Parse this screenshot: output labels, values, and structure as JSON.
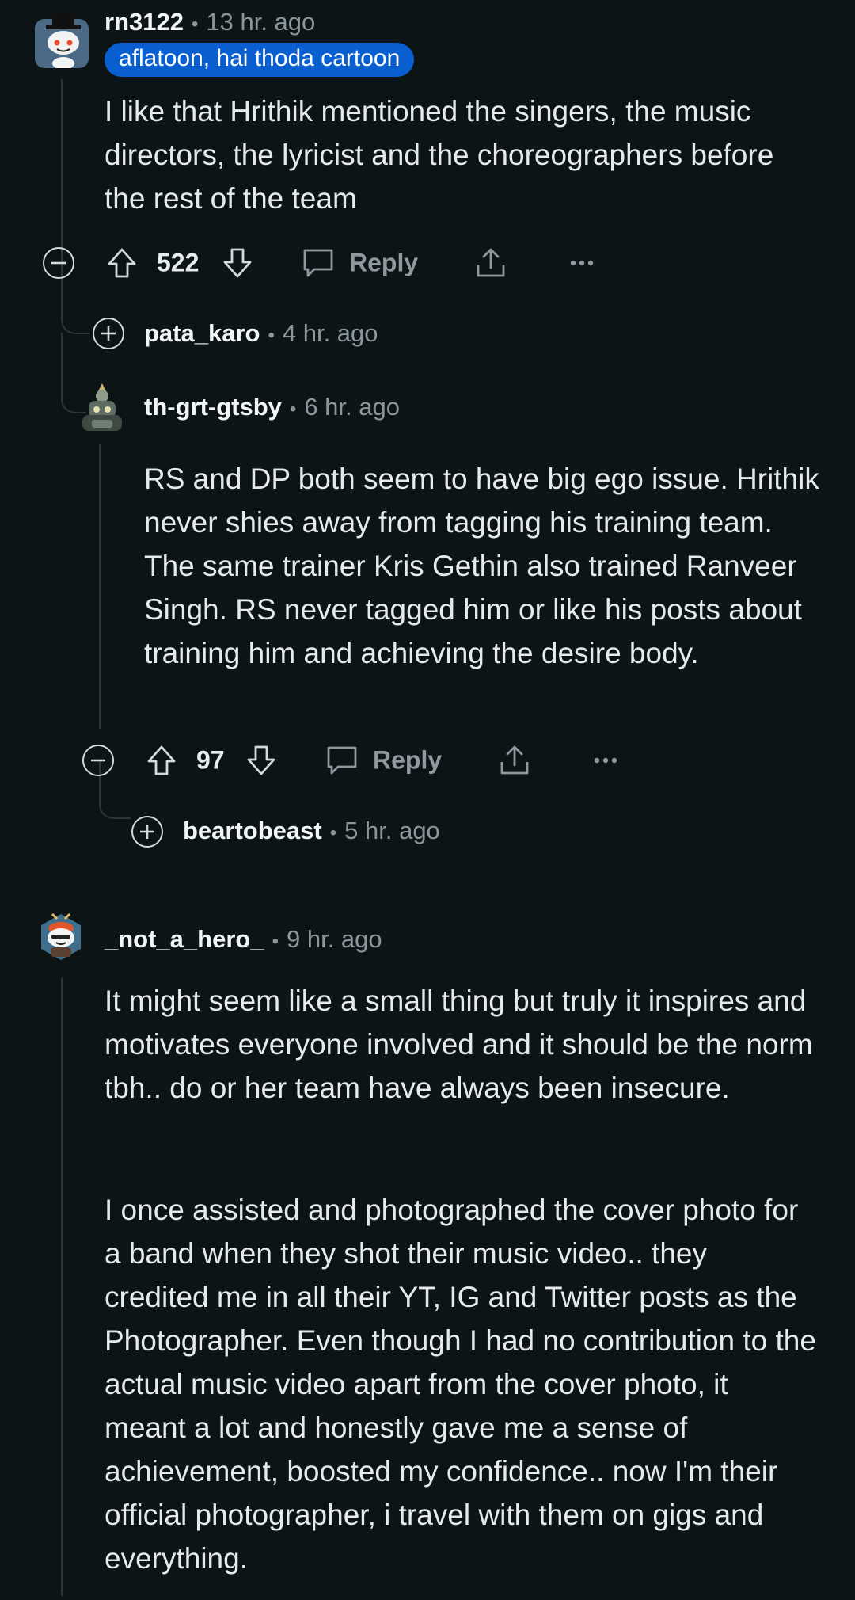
{
  "comments": [
    {
      "username": "rn3122",
      "time": "13 hr. ago",
      "flair": "aflatoon, hai thoda cartoon",
      "text": "I like that Hrithik mentioned the singers, the music directors, the lyricist and the choreographers before the rest of the team",
      "votes": "522",
      "reply_label": "Reply",
      "avatar_icon": "snoo-avatar-tophat-icon"
    },
    {
      "username": "pata_karo",
      "time": "4 hr. ago",
      "collapsed": true
    },
    {
      "username": "th-grt-gtsby",
      "time": "6 hr. ago",
      "text": "RS and DP both seem to have big ego issue. Hrithik never shies away from tagging his training team. The same trainer Kris Gethin also trained Ranveer Singh. RS never tagged him or like his posts about training him and achieving the desire body.",
      "votes": "97",
      "reply_label": "Reply",
      "avatar_icon": "robot-avatar-icon"
    },
    {
      "username": "beartobeast",
      "time": "5 hr. ago",
      "collapsed": true
    },
    {
      "username": "_not_a_hero_",
      "time": "9 hr. ago",
      "text_p1": "It might seem like a small thing but truly it inspires and motivates everyone involved and it should be the norm tbh.. do or her team have always been insecure.",
      "text_p2": "I once assisted and photographed the cover photo for a band when they shot their music video.. they credited me in all their YT, IG and Twitter posts as the Photographer. Even though I had no contribution to the actual music video apart from the cover photo, it meant a lot and honestly gave me a sense of achievement, boosted my confidence.. now I'm their official photographer, i travel with them on gigs and everything.",
      "avatar_icon": "snoo-avatar-redhair-icon"
    }
  ],
  "colors": {
    "background": "#0c1416",
    "flair": "#0a5fd0",
    "muted": "#8a979c"
  }
}
